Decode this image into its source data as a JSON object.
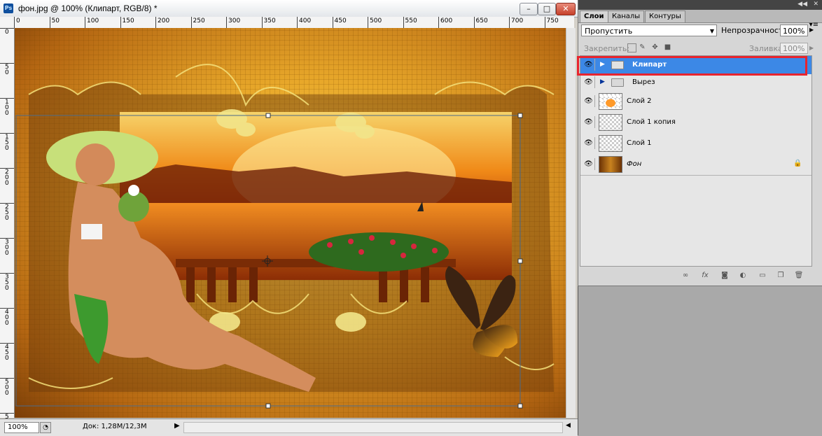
{
  "document": {
    "title": "фон.jpg @ 100% (Клипарт, RGB/8) *",
    "app_icon_text": "Ps",
    "window_buttons": {
      "minimize": "–",
      "maximize": "□",
      "close": "✕"
    },
    "ruler_top": [
      "0",
      "50",
      "100",
      "150",
      "200",
      "250",
      "300",
      "350",
      "400",
      "450",
      "500",
      "550",
      "600",
      "650",
      "700",
      "750"
    ],
    "ruler_left": [
      "0",
      "5 0",
      "1 0 0",
      "1 5 0",
      "2 0 0",
      "2 5 0",
      "3 0 0",
      "3 5 0",
      "4 0 0",
      "4 5 0",
      "5 0 0",
      "5 5 0"
    ],
    "zoom": "100%",
    "doc_info": "Док: 1,28М/12,3М",
    "status_arrow": "▶"
  },
  "panel": {
    "tabs": [
      "Слои",
      "Каналы",
      "Контуры"
    ],
    "active_tab": "Слои",
    "blend_mode": "Пропустить",
    "opacity_label": "Непрозрачность:",
    "opacity_value": "100%",
    "lock_label": "Закрепить:",
    "fill_label": "Заливка:",
    "fill_value": "100%",
    "layers": [
      {
        "name": "Клипарт",
        "type": "group",
        "selected": true
      },
      {
        "name": "Вырез",
        "type": "group",
        "selected": false
      },
      {
        "name": "Слой 2",
        "type": "layer",
        "thumb": "sunset"
      },
      {
        "name": "Слой 1 копия",
        "type": "layer",
        "thumb": "checker"
      },
      {
        "name": "Слой 1",
        "type": "layer",
        "thumb": "checker"
      },
      {
        "name": "Фон",
        "type": "background",
        "thumb": "wood",
        "locked": true
      }
    ]
  },
  "colors": {
    "selection": "#3c88e6",
    "highlight_box": "#e8242e"
  }
}
